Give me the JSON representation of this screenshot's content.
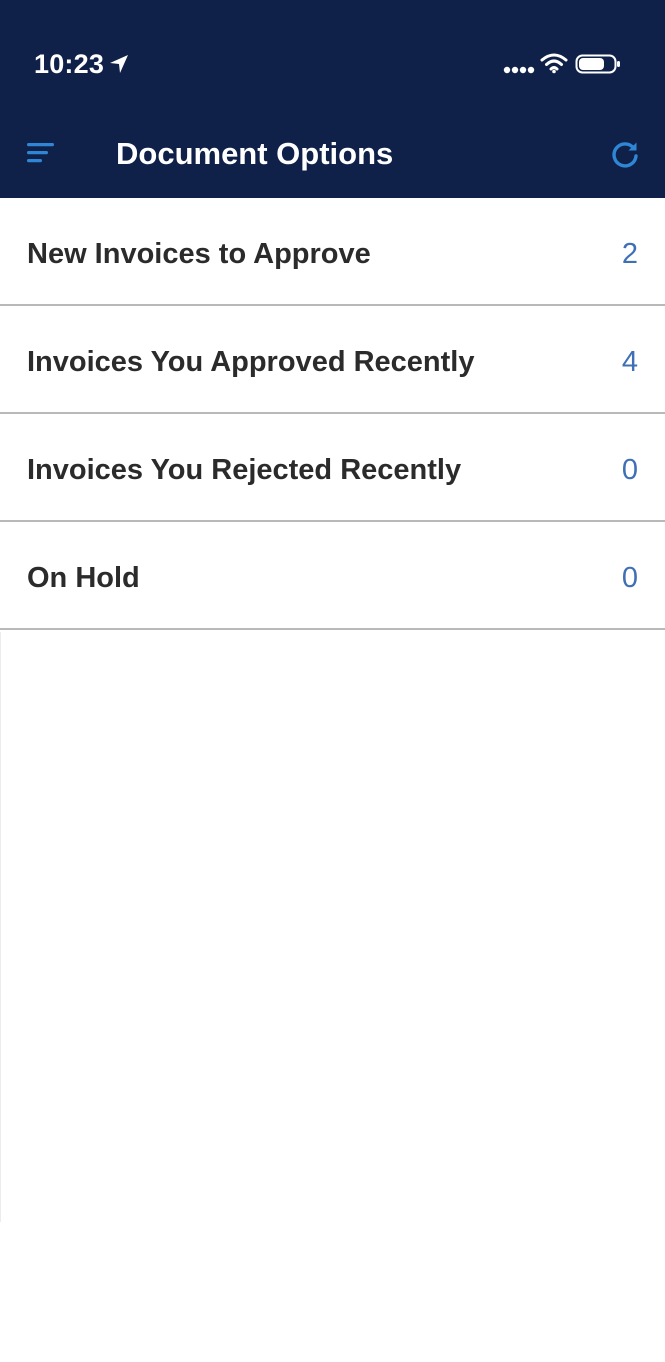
{
  "status_bar": {
    "time": "10:23",
    "icons": [
      "location-arrow-icon",
      "signal-dots-icon",
      "wifi-icon",
      "battery-icon"
    ]
  },
  "header": {
    "title": "Document Options",
    "left_icon": "menu-icon",
    "right_icon": "refresh-icon"
  },
  "colors": {
    "header_bg": "#0f2148",
    "accent": "#2f86d6",
    "count_text": "#3f6fb5",
    "label_text": "#2b2b2b",
    "divider": "#b9b9b9"
  },
  "options": [
    {
      "label": "New Invoices to Approve",
      "count": "2"
    },
    {
      "label": "Invoices You Approved Recently",
      "count": "4"
    },
    {
      "label": "Invoices You Rejected Recently",
      "count": "0"
    },
    {
      "label": "On Hold",
      "count": "0"
    }
  ]
}
